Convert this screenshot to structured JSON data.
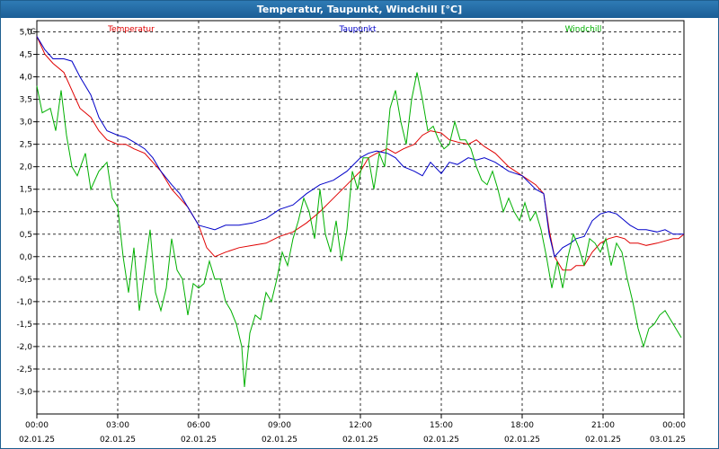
{
  "window": {
    "title": "Temperatur, Taupunkt, Windchill [°C]"
  },
  "chart_data": {
    "type": "line",
    "title": "Temperatur, Taupunkt, Windchill [°C]",
    "ylabel": "°C",
    "ylim": [
      -3.5,
      5.25
    ],
    "xlim": [
      0,
      24
    ],
    "grid": true,
    "y_ticks": [
      "5,0",
      "4,5",
      "4,0",
      "3,5",
      "3,0",
      "2,5",
      "2,0",
      "1,5",
      "1,0",
      "0,5",
      "0,0",
      "-0,5",
      "-1,0",
      "-1,5",
      "-2,0",
      "-2,5",
      "-3,0"
    ],
    "y_tick_values": [
      5,
      4.5,
      4,
      3.5,
      3,
      2.5,
      2,
      1.5,
      1,
      0.5,
      0,
      -0.5,
      -1,
      -1.5,
      -2,
      -2.5,
      -3
    ],
    "x_ticks": [
      {
        "time": "00:00",
        "date": "02.01.25"
      },
      {
        "time": "03:00",
        "date": "02.01.25"
      },
      {
        "time": "06:00",
        "date": "02.01.25"
      },
      {
        "time": "09:00",
        "date": "02.01.25"
      },
      {
        "time": "12:00",
        "date": "02.01.25"
      },
      {
        "time": "15:00",
        "date": "02.01.25"
      },
      {
        "time": "18:00",
        "date": "02.01.25"
      },
      {
        "time": "21:00",
        "date": "02.01.25"
      },
      {
        "time": "00:00",
        "date": "03.01.25"
      }
    ],
    "legend_placement": "top",
    "series": [
      {
        "name": "Temperatur",
        "color": "#e00000",
        "points": [
          [
            0,
            4.9
          ],
          [
            0.3,
            4.5
          ],
          [
            0.6,
            4.3
          ],
          [
            1,
            4.1
          ],
          [
            1.3,
            3.7
          ],
          [
            1.6,
            3.3
          ],
          [
            2,
            3.1
          ],
          [
            2.3,
            2.8
          ],
          [
            2.6,
            2.6
          ],
          [
            3,
            2.5
          ],
          [
            3.3,
            2.5
          ],
          [
            3.6,
            2.4
          ],
          [
            4,
            2.3
          ],
          [
            4.3,
            2.1
          ],
          [
            4.6,
            1.9
          ],
          [
            5,
            1.5
          ],
          [
            5.3,
            1.3
          ],
          [
            5.6,
            1.1
          ],
          [
            6,
            0.7
          ],
          [
            6.3,
            0.2
          ],
          [
            6.6,
            0
          ],
          [
            7,
            0.1
          ],
          [
            7.5,
            0.2
          ],
          [
            8,
            0.25
          ],
          [
            8.5,
            0.3
          ],
          [
            9,
            0.45
          ],
          [
            9.5,
            0.55
          ],
          [
            10,
            0.75
          ],
          [
            10.5,
            1.0
          ],
          [
            11,
            1.3
          ],
          [
            11.5,
            1.6
          ],
          [
            12,
            1.9
          ],
          [
            12.3,
            2.2
          ],
          [
            12.6,
            2.3
          ],
          [
            13,
            2.4
          ],
          [
            13.3,
            2.3
          ],
          [
            13.6,
            2.4
          ],
          [
            14,
            2.5
          ],
          [
            14.3,
            2.7
          ],
          [
            14.6,
            2.8
          ],
          [
            15,
            2.75
          ],
          [
            15.3,
            2.6
          ],
          [
            15.6,
            2.55
          ],
          [
            16,
            2.5
          ],
          [
            16.3,
            2.6
          ],
          [
            16.6,
            2.45
          ],
          [
            17,
            2.3
          ],
          [
            17.5,
            2.0
          ],
          [
            18,
            1.8
          ],
          [
            18.5,
            1.6
          ],
          [
            18.8,
            1.4
          ],
          [
            19,
            0.6
          ],
          [
            19.2,
            0
          ],
          [
            19.5,
            -0.3
          ],
          [
            19.8,
            -0.3
          ],
          [
            20,
            -0.2
          ],
          [
            20.3,
            -0.2
          ],
          [
            20.6,
            0.1
          ],
          [
            20.9,
            0.3
          ],
          [
            21.2,
            0.4
          ],
          [
            21.5,
            0.45
          ],
          [
            21.8,
            0.4
          ],
          [
            22,
            0.3
          ],
          [
            22.3,
            0.3
          ],
          [
            22.6,
            0.25
          ],
          [
            23,
            0.3
          ],
          [
            23.3,
            0.35
          ],
          [
            23.6,
            0.4
          ],
          [
            23.8,
            0.4
          ],
          [
            24,
            0.5
          ]
        ]
      },
      {
        "name": "Taupunkt",
        "color": "#0000c8",
        "points": [
          [
            0,
            4.9
          ],
          [
            0.3,
            4.6
          ],
          [
            0.6,
            4.4
          ],
          [
            1,
            4.4
          ],
          [
            1.3,
            4.35
          ],
          [
            1.6,
            4.0
          ],
          [
            2,
            3.6
          ],
          [
            2.3,
            3.1
          ],
          [
            2.6,
            2.8
          ],
          [
            3,
            2.7
          ],
          [
            3.3,
            2.65
          ],
          [
            3.6,
            2.55
          ],
          [
            4,
            2.4
          ],
          [
            4.3,
            2.2
          ],
          [
            4.6,
            1.9
          ],
          [
            5,
            1.6
          ],
          [
            5.3,
            1.4
          ],
          [
            5.6,
            1.1
          ],
          [
            6,
            0.7
          ],
          [
            6.3,
            0.65
          ],
          [
            6.6,
            0.6
          ],
          [
            7,
            0.7
          ],
          [
            7.5,
            0.7
          ],
          [
            8,
            0.75
          ],
          [
            8.5,
            0.85
          ],
          [
            9,
            1.05
          ],
          [
            9.5,
            1.15
          ],
          [
            10,
            1.4
          ],
          [
            10.5,
            1.6
          ],
          [
            11,
            1.7
          ],
          [
            11.5,
            1.9
          ],
          [
            12,
            2.2
          ],
          [
            12.3,
            2.3
          ],
          [
            12.6,
            2.35
          ],
          [
            13,
            2.3
          ],
          [
            13.3,
            2.2
          ],
          [
            13.6,
            2.0
          ],
          [
            14,
            1.9
          ],
          [
            14.3,
            1.8
          ],
          [
            14.6,
            2.1
          ],
          [
            15,
            1.85
          ],
          [
            15.3,
            2.1
          ],
          [
            15.6,
            2.05
          ],
          [
            16,
            2.2
          ],
          [
            16.3,
            2.15
          ],
          [
            16.6,
            2.2
          ],
          [
            17,
            2.1
          ],
          [
            17.5,
            1.9
          ],
          [
            18,
            1.8
          ],
          [
            18.5,
            1.5
          ],
          [
            18.8,
            1.4
          ],
          [
            19,
            0.5
          ],
          [
            19.2,
            0
          ],
          [
            19.5,
            0.2
          ],
          [
            19.8,
            0.3
          ],
          [
            20,
            0.4
          ],
          [
            20.3,
            0.45
          ],
          [
            20.6,
            0.8
          ],
          [
            20.9,
            0.95
          ],
          [
            21.2,
            1.0
          ],
          [
            21.5,
            0.95
          ],
          [
            21.8,
            0.8
          ],
          [
            22,
            0.7
          ],
          [
            22.3,
            0.6
          ],
          [
            22.6,
            0.6
          ],
          [
            23,
            0.55
          ],
          [
            23.3,
            0.6
          ],
          [
            23.6,
            0.5
          ],
          [
            23.8,
            0.5
          ],
          [
            24,
            0.5
          ]
        ]
      },
      {
        "name": "Windchill",
        "color": "#00b000",
        "points": [
          [
            0,
            3.8
          ],
          [
            0.2,
            3.2
          ],
          [
            0.5,
            3.3
          ],
          [
            0.7,
            2.8
          ],
          [
            0.9,
            3.7
          ],
          [
            1.1,
            2.7
          ],
          [
            1.3,
            2.0
          ],
          [
            1.5,
            1.8
          ],
          [
            1.8,
            2.3
          ],
          [
            2,
            1.5
          ],
          [
            2.3,
            1.9
          ],
          [
            2.6,
            2.1
          ],
          [
            2.8,
            1.3
          ],
          [
            3,
            1.1
          ],
          [
            3.2,
            0
          ],
          [
            3.4,
            -0.8
          ],
          [
            3.6,
            0.2
          ],
          [
            3.8,
            -1.2
          ],
          [
            4,
            -0.3
          ],
          [
            4.2,
            0.6
          ],
          [
            4.4,
            -0.8
          ],
          [
            4.6,
            -1.2
          ],
          [
            4.8,
            -0.7
          ],
          [
            5,
            0.4
          ],
          [
            5.2,
            -0.3
          ],
          [
            5.4,
            -0.5
          ],
          [
            5.6,
            -1.3
          ],
          [
            5.8,
            -0.6
          ],
          [
            6,
            -0.7
          ],
          [
            6.2,
            -0.6
          ],
          [
            6.4,
            -0.1
          ],
          [
            6.6,
            -0.5
          ],
          [
            6.8,
            -0.5
          ],
          [
            7,
            -1.0
          ],
          [
            7.2,
            -1.2
          ],
          [
            7.4,
            -1.5
          ],
          [
            7.6,
            -2.0
          ],
          [
            7.7,
            -2.9
          ],
          [
            7.9,
            -1.7
          ],
          [
            8.1,
            -1.3
          ],
          [
            8.3,
            -1.4
          ],
          [
            8.5,
            -0.8
          ],
          [
            8.7,
            -1.0
          ],
          [
            8.9,
            -0.5
          ],
          [
            9.1,
            0.1
          ],
          [
            9.3,
            -0.2
          ],
          [
            9.5,
            0.4
          ],
          [
            9.7,
            0.8
          ],
          [
            9.9,
            1.3
          ],
          [
            10.1,
            1.0
          ],
          [
            10.3,
            0.4
          ],
          [
            10.5,
            1.5
          ],
          [
            10.7,
            0.5
          ],
          [
            10.9,
            0.1
          ],
          [
            11.1,
            0.8
          ],
          [
            11.3,
            -0.1
          ],
          [
            11.5,
            0.6
          ],
          [
            11.7,
            1.9
          ],
          [
            11.9,
            1.5
          ],
          [
            12.1,
            2.2
          ],
          [
            12.3,
            2.2
          ],
          [
            12.5,
            1.5
          ],
          [
            12.7,
            2.3
          ],
          [
            12.9,
            2.0
          ],
          [
            13.1,
            3.3
          ],
          [
            13.3,
            3.7
          ],
          [
            13.5,
            3.0
          ],
          [
            13.7,
            2.5
          ],
          [
            13.9,
            3.5
          ],
          [
            14.1,
            4.1
          ],
          [
            14.3,
            3.5
          ],
          [
            14.5,
            2.8
          ],
          [
            14.7,
            2.9
          ],
          [
            14.9,
            2.6
          ],
          [
            15.1,
            2.4
          ],
          [
            15.3,
            2.5
          ],
          [
            15.5,
            3.0
          ],
          [
            15.7,
            2.6
          ],
          [
            15.9,
            2.6
          ],
          [
            16.1,
            2.4
          ],
          [
            16.3,
            2.0
          ],
          [
            16.5,
            1.7
          ],
          [
            16.7,
            1.6
          ],
          [
            16.9,
            1.9
          ],
          [
            17.1,
            1.5
          ],
          [
            17.3,
            1.0
          ],
          [
            17.5,
            1.3
          ],
          [
            17.7,
            1.0
          ],
          [
            17.9,
            0.8
          ],
          [
            18.1,
            1.2
          ],
          [
            18.3,
            0.8
          ],
          [
            18.5,
            1.0
          ],
          [
            18.7,
            0.6
          ],
          [
            18.9,
            0
          ],
          [
            19.1,
            -0.7
          ],
          [
            19.3,
            -0.1
          ],
          [
            19.5,
            -0.7
          ],
          [
            19.7,
            0
          ],
          [
            19.9,
            0.5
          ],
          [
            20.1,
            0.2
          ],
          [
            20.3,
            -0.2
          ],
          [
            20.5,
            0.4
          ],
          [
            20.7,
            0.3
          ],
          [
            20.9,
            0.1
          ],
          [
            21.1,
            0.4
          ],
          [
            21.3,
            -0.2
          ],
          [
            21.5,
            0.3
          ],
          [
            21.7,
            0.1
          ],
          [
            21.9,
            -0.5
          ],
          [
            22.1,
            -1.0
          ],
          [
            22.3,
            -1.6
          ],
          [
            22.5,
            -2.0
          ],
          [
            22.7,
            -1.6
          ],
          [
            22.9,
            -1.5
          ],
          [
            23.1,
            -1.3
          ],
          [
            23.3,
            -1.2
          ],
          [
            23.5,
            -1.4
          ],
          [
            23.7,
            -1.6
          ],
          [
            23.9,
            -1.8
          ]
        ]
      }
    ]
  }
}
